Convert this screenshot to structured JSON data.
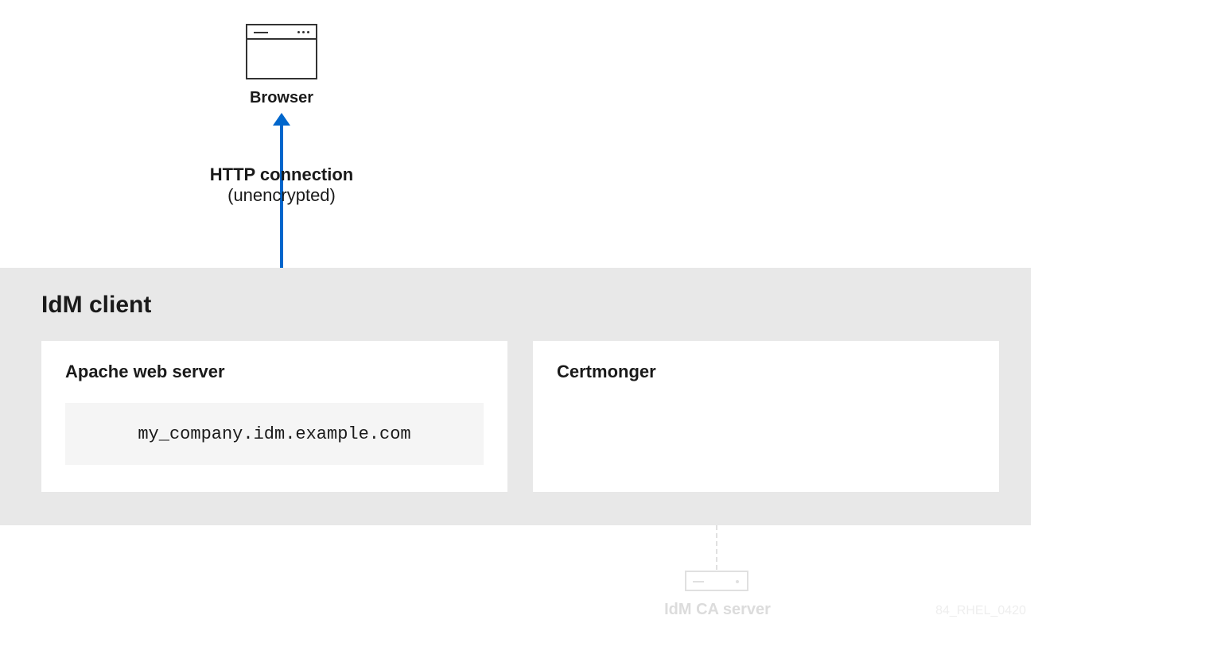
{
  "browser": {
    "label": "Browser"
  },
  "connection": {
    "line1": "HTTP connection",
    "line2": "(unencrypted)"
  },
  "idm_client": {
    "title": "IdM client",
    "apache": {
      "title": "Apache web server",
      "hostname": "my_company.idm.example.com"
    },
    "certmonger": {
      "title": "Certmonger"
    }
  },
  "ca_server": {
    "label": "IdM CA server"
  },
  "footer": {
    "code": "84_RHEL_0420"
  }
}
